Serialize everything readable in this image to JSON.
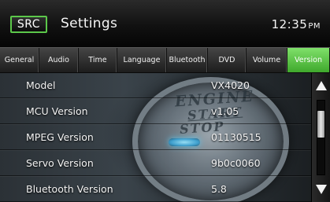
{
  "header": {
    "source_button": "SRC",
    "title": "Settings",
    "time": "12:35",
    "ampm": "PM"
  },
  "tabs": [
    {
      "label": "General",
      "active": false
    },
    {
      "label": "Audio",
      "active": false
    },
    {
      "label": "Time",
      "active": false
    },
    {
      "label": "Language",
      "active": false
    },
    {
      "label": "Bluetooth",
      "active": false
    },
    {
      "label": "DVD",
      "active": false
    },
    {
      "label": "Volume",
      "active": false
    },
    {
      "label": "Version",
      "active": true
    }
  ],
  "background": {
    "line1": "ENGINE",
    "line2": "START",
    "line3": "STOP"
  },
  "version_info": [
    {
      "label": "Model",
      "value": "VX4020"
    },
    {
      "label": "MCU Version",
      "value": "v1.05"
    },
    {
      "label": "MPEG Version",
      "value": "01130515"
    },
    {
      "label": "Servo Version",
      "value": "9b0c0060"
    },
    {
      "label": "Bluetooth Version",
      "value": "5.8"
    }
  ],
  "scrollbar": {
    "position_fraction": 0.14,
    "visible_fraction": 0.36
  },
  "colors": {
    "accent": "#5cc84a",
    "active_tab": "#5fc74a",
    "text": "#f2f2f2",
    "background": "#000000"
  },
  "icons": {
    "scroll_up": "triangle-up-icon",
    "scroll_down": "triangle-down-icon"
  }
}
